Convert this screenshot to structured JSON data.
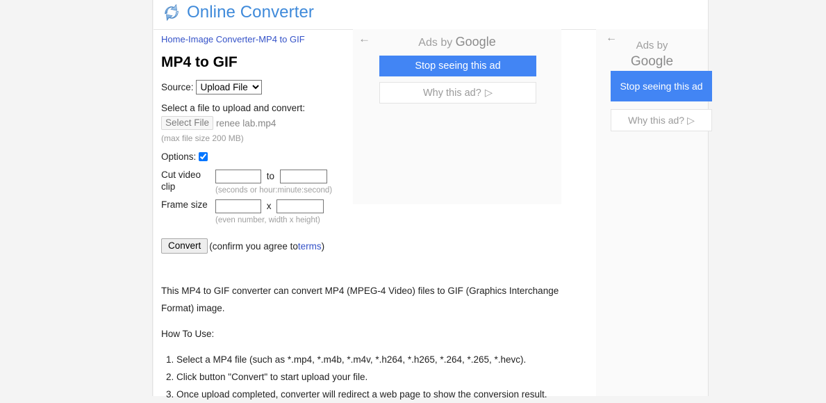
{
  "header": {
    "logo_icon": "convert-arrows-icon",
    "site_name": "Online Converter"
  },
  "breadcrumb": {
    "home": "Home",
    "sep1": "-",
    "category": "Image Converter",
    "sep2": "-",
    "current": "MP4 to GIF"
  },
  "page_title": "MP4 to GIF",
  "form": {
    "source_label": "Source:",
    "source_value": "Upload File",
    "source_options": [
      "Upload File"
    ],
    "upload_instruction": "Select a file to upload and convert:",
    "file_button_label": "Select File",
    "file_name": "renee lab.mp4",
    "max_size_hint": "(max file size 200 MB)",
    "options_label": "Options:",
    "options_checked": true,
    "cut_label_line1": "Cut video",
    "cut_label_line2": "clip",
    "cut_from_value": "",
    "cut_to_separator": "to",
    "cut_to_value": "",
    "cut_hint": "(seconds or hour:minute:second)",
    "frame_label": "Frame size",
    "frame_width_value": "",
    "frame_separator": "x",
    "frame_height_value": "",
    "frame_hint": "(even number, width x height)",
    "convert_button": "Convert",
    "confirm_prefix": "(confirm you agree to",
    "terms_link": "terms",
    "confirm_suffix": ")"
  },
  "description": {
    "intro": "This MP4 to GIF converter can convert MP4 (MPEG-4 Video) files to GIF (Graphics Interchange Format) image.",
    "howto_title": "How To Use:",
    "steps": [
      "Select a MP4 file (such as *.mp4, *.m4b, *.m4v, *.h264, *.h265, *.264, *.265, *.hevc).",
      "Click button \"Convert\" to start upload your file.",
      "Once upload completed, converter will redirect a web page to show the conversion result."
    ]
  },
  "ads": {
    "center": {
      "back_icon": "left-arrow-icon",
      "ads_by_prefix": "Ads by ",
      "ads_by_brand": "Google",
      "stop_label": "Stop seeing this ad",
      "why_label": "Why this ad?",
      "why_icon": "play-triangle-icon"
    },
    "right": {
      "back_icon": "left-arrow-icon",
      "ads_by_prefix": "Ads by",
      "ads_by_brand": "Google",
      "stop_label": "Stop seeing this ad",
      "why_label": "Why this ad?",
      "why_icon": "play-triangle-icon"
    }
  },
  "colors": {
    "brand_blue": "#3f8ada",
    "link_blue": "#3452c8",
    "ad_blue": "#4285f4",
    "page_gray": "#f4f4f4"
  }
}
